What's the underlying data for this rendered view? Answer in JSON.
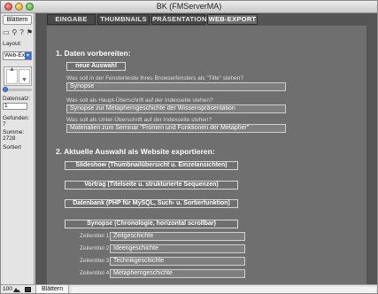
{
  "window": {
    "title": "BK (FMServerMA)"
  },
  "sidebar": {
    "mode_button": "Blättern",
    "layout_label": "Layout:",
    "layout_value": "Web-Exp",
    "record_label": "Datensatz:",
    "record_value": "1",
    "found_label": "Gefunden:",
    "found_value": "7",
    "total_label": "Summe:",
    "total_value": "2728",
    "sort_status": "Sortiert"
  },
  "tabs": [
    {
      "label": "EINGABE"
    },
    {
      "label": "THUMBNAILS"
    },
    {
      "label": "PRÄSENTATION"
    },
    {
      "label": "WEB-EXPORT"
    }
  ],
  "section1": {
    "heading": "1. Daten vorbereiten:",
    "new_button": "neue Auswahl",
    "q1": "Was soll in der Fensterleiste Ihres Browserfensters als \"Title\" stehen?",
    "a1": "Synopse",
    "q2": "Was soll als Haupt-Überschrift auf der Indexseite stehen?",
    "a2": "Synopse zur Metapherngeschichte der Wissenspräsentation",
    "q3": "Was soll als Unter-Überschrift auf der Indexseite stehen?",
    "a3": "Materialien zum Seminar \"Fromen und Funktionen der Metapher\""
  },
  "section2": {
    "heading": "2. Aktuelle Auswahl als Website exportieren:",
    "btn_slideshow": "Slideshow (Thumbnailübersicht u. Einzelansichten)",
    "btn_vortrag": "Vortrag (Titelseite u. strukturierte Sequenzen)",
    "btn_datenbank": "Datenbank (PHP für MySQL, Such- u. Sortierfunktion)",
    "btn_synopse": "Synopse (Chronologie, horizontal scrollbar)",
    "rows": [
      {
        "label": "Zeilentitel 1",
        "value": "Zeitgeschichte"
      },
      {
        "label": "Zeilentitel 2",
        "value": "Ideengeschichte"
      },
      {
        "label": "Zeilentitel 3",
        "value": "Technikgeschichte"
      },
      {
        "label": "Zeilentitel 4",
        "value": "Metapherngeschichte"
      }
    ]
  },
  "statusbar": {
    "zoom": "100",
    "mode": "Blättern"
  }
}
